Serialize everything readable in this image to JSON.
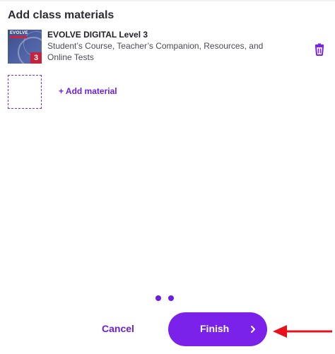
{
  "section": {
    "title": "Add class materials"
  },
  "material": {
    "name": "EVOLVE DIGITAL Level 3",
    "description_line1": "Student’s Course, Teacher’s Companion, Resources, and",
    "description_line2": "Online Tests",
    "cover": {
      "brand": "EVOLVE",
      "level": "3",
      "colors": {
        "cover_blue": "#4a5ea0",
        "cover_red": "#c8213a"
      }
    },
    "delete_icon": "trash-icon"
  },
  "add": {
    "label": "+ Add material"
  },
  "pager": {
    "dots": 2
  },
  "footer": {
    "cancel_label": "Cancel",
    "finish_label": "Finish",
    "finish_icon": "chevron-right-icon"
  },
  "annotation": {
    "icon": "red-arrow-icon",
    "color": "#e8101a"
  },
  "colors": {
    "accent": "#7a22ea",
    "text_dark": "#2b2b33",
    "text_muted": "#4a4a55"
  }
}
